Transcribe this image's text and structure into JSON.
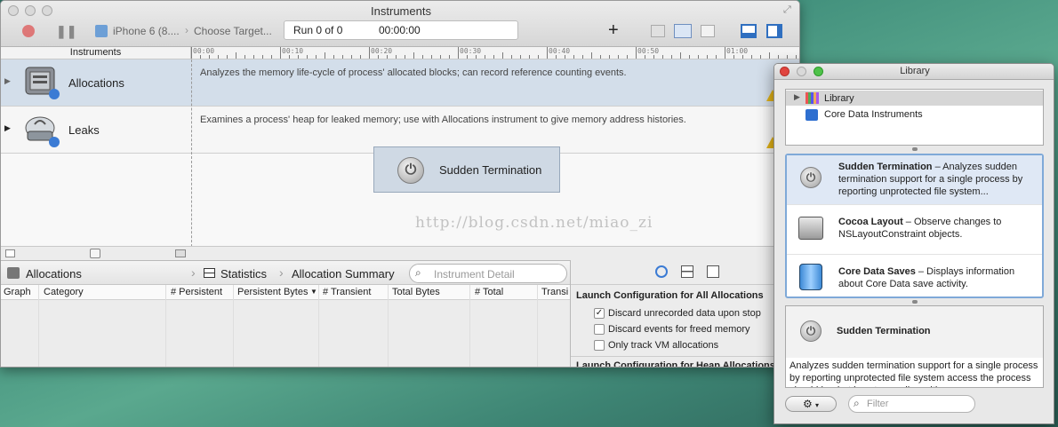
{
  "window": {
    "title": "Instruments"
  },
  "toolbar": {
    "device": "iPhone 6 (8....",
    "target": "Choose Target...",
    "run_label": "Run 0 of 0",
    "time": "00:00:00",
    "add_glyph": "+"
  },
  "ruler": {
    "header": "Instruments",
    "ticks": [
      "00:00",
      "00:10",
      "00:20",
      "00:30",
      "00:40",
      "00:50",
      "01:00"
    ]
  },
  "instruments": [
    {
      "name": "Allocations",
      "description": "Analyzes the memory life-cycle of process' allocated blocks; can record reference counting events.",
      "selected": true
    },
    {
      "name": "Leaks",
      "description": "Examines a process' heap for leaked memory; use with Allocations instrument to give memory address histories.",
      "selected": false
    }
  ],
  "drop_hint": {
    "label": "Sudden Termination"
  },
  "watermark": "http://blog.csdn.net/miao_zi",
  "pathbar": {
    "instrument": "Allocations",
    "view": "Statistics",
    "summary": "Allocation Summary",
    "search_placeholder": "Instrument Detail"
  },
  "columns": [
    "Graph",
    "Category",
    "# Persistent",
    "Persistent Bytes",
    "# Transient",
    "Total Bytes",
    "# Total",
    "Transi"
  ],
  "config": {
    "section1": "Launch Configuration for All Allocations",
    "options": [
      {
        "label": "Discard unrecorded data upon stop",
        "checked": true
      },
      {
        "label": "Discard events for freed memory",
        "checked": false
      },
      {
        "label": "Only track VM allocations",
        "checked": false
      }
    ],
    "section2": "Launch Configuration for Heap Allocations"
  },
  "library": {
    "title": "Library",
    "tree": [
      "Library",
      "Core Data Instruments"
    ],
    "items": [
      {
        "name": "Sudden Termination",
        "desc": " – Analyzes sudden termination support for a single process by reporting unprotected file system..."
      },
      {
        "name": "Cocoa Layout",
        "desc": " – Observe changes to NSLayoutConstraint objects."
      },
      {
        "name": "Core Data Saves",
        "desc": " – Displays information about Core Data save activity."
      }
    ],
    "detail_title": "Sudden Termination",
    "detail_text": "Analyzes sudden termination support for a single process by reporting unprotected file system access the process should be, but is not, guarding with",
    "filter_placeholder": "Filter",
    "gear_glyph": "⚙"
  },
  "colors": {
    "selection": "#d3deea",
    "accent": "#3b7bd4",
    "warning": "#e2b318"
  }
}
